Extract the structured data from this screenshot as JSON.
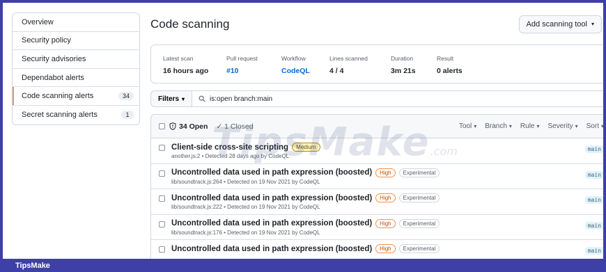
{
  "sidebar": {
    "items": [
      {
        "label": "Overview",
        "count": ""
      },
      {
        "label": "Security policy",
        "count": ""
      },
      {
        "label": "Security advisories",
        "count": ""
      },
      {
        "label": "Dependabot alerts",
        "count": ""
      },
      {
        "label": "Code scanning alerts",
        "count": "34"
      },
      {
        "label": "Secret scanning alerts",
        "count": "1"
      }
    ]
  },
  "header": {
    "title": "Code scanning",
    "add_button": "Add scanning tool"
  },
  "summary": {
    "latest_scan_label": "Latest scan",
    "latest_scan": "16 hours ago",
    "pull_request_label": "Pull request",
    "pull_request": "#10",
    "workflow_label": "Workflow",
    "workflow": "CodeQL",
    "lines_label": "Lines scanned",
    "lines": "4 / 4",
    "duration_label": "Duration",
    "duration": "3m 21s",
    "result_label": "Result",
    "result": "0 alerts"
  },
  "filter": {
    "button": "Filters",
    "query": "is:open branch:main"
  },
  "alerts_header": {
    "open": "34 Open",
    "closed": "1 Closed",
    "tool": "Tool",
    "branch": "Branch",
    "rule": "Rule",
    "severity": "Severity",
    "sort": "Sort"
  },
  "alerts": [
    {
      "title": "Client-side cross-site scripting",
      "severity": "Medium",
      "experimental": "",
      "meta": "another.js:2 • Detected 28 days ago by CodeQL",
      "branch": "main"
    },
    {
      "title": "Uncontrolled data used in path expression (boosted)",
      "severity": "High",
      "experimental": "Experimental",
      "meta": "lib/soundtrack.js:264 • Detected on 19 Nov 2021 by CodeQL",
      "branch": "main"
    },
    {
      "title": "Uncontrolled data used in path expression (boosted)",
      "severity": "High",
      "experimental": "Experimental",
      "meta": "lib/soundtrack.js:222 • Detected on 19 Nov 2021 by CodeQL",
      "branch": "main"
    },
    {
      "title": "Uncontrolled data used in path expression (boosted)",
      "severity": "High",
      "experimental": "Experimental",
      "meta": "lib/soundtrack.js:176 • Detected on 19 Nov 2021 by CodeQL",
      "branch": "main"
    },
    {
      "title": "Uncontrolled data used in path expression (boosted)",
      "severity": "High",
      "experimental": "Experimental",
      "meta": "",
      "branch": "main"
    }
  ],
  "watermark": {
    "text": "TipsMake",
    "suffix": ".com"
  },
  "footer": {
    "brand": "TipsMake"
  }
}
